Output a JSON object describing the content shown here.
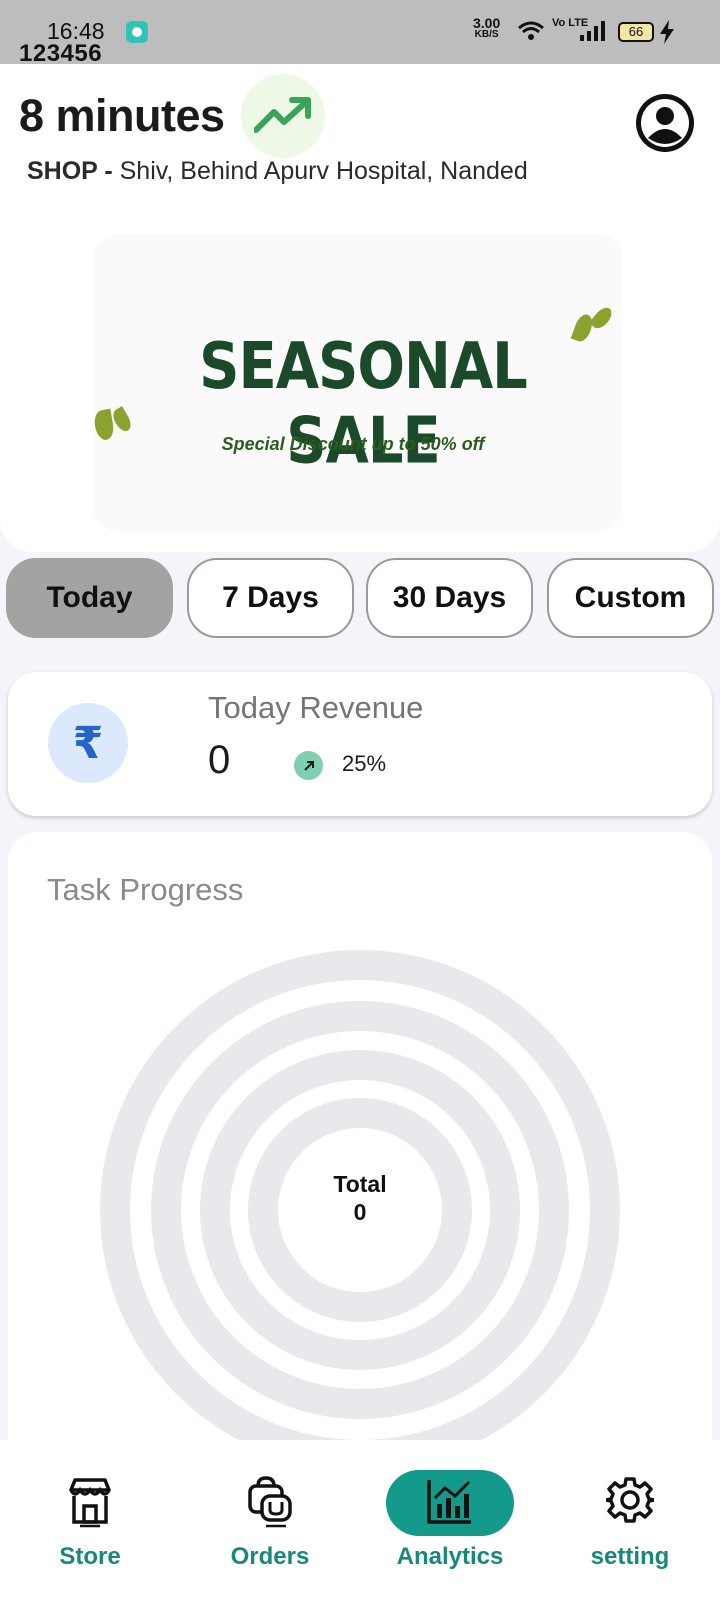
{
  "status_bar": {
    "time": "16:48",
    "sub_label": "123456",
    "speed_value": "3.00",
    "speed_unit": "KB/S",
    "volte": "Vo LTE",
    "battery": "66"
  },
  "header": {
    "eta": "8 minutes",
    "address_prefix": "SHOP -",
    "address": "Shiv, Behind Apurv Hospital, Nanded"
  },
  "banner": {
    "title": "SEASONAL SALE",
    "subtitle": "Special Discount up to 50% off"
  },
  "filters": [
    {
      "label": "Today",
      "active": true
    },
    {
      "label": "7 Days",
      "active": false
    },
    {
      "label": "30 Days",
      "active": false
    },
    {
      "label": "Custom",
      "active": false
    }
  ],
  "revenue": {
    "label": "Today Revenue",
    "value": "0",
    "change": "25%",
    "currency_icon": "rupee-icon"
  },
  "task_progress": {
    "title": "Task Progress",
    "total_label": "Total",
    "total_value": "0"
  },
  "nav": {
    "items": [
      {
        "label": "Store",
        "icon": "store-icon"
      },
      {
        "label": "Orders",
        "icon": "orders-icon"
      },
      {
        "label": "Analytics",
        "icon": "analytics-icon",
        "active": true
      },
      {
        "label": "setting",
        "icon": "gear-icon"
      }
    ],
    "active_color": "#149a8a",
    "label_color": "#17887a"
  }
}
